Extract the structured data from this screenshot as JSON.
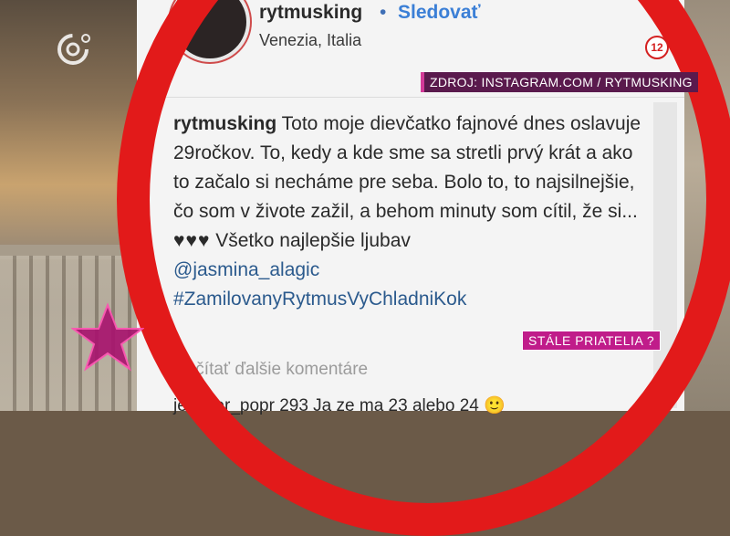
{
  "post": {
    "header_username": "rytmusking",
    "header_dot": "•",
    "follow_label": "Sledovať",
    "location": "Venezia, Italia"
  },
  "caption": {
    "username": "rytmusking",
    "text": "Toto moje dievčatko fajnové dnes oslavuje 29ročkov. To, kedy a kde sme sa stretli prvý krát a ako to začalo si necháme pre seba. Bolo to, to najsilnejšie, čo som v živote zažil, a behom minuty som cítil, že si...",
    "hearts": "♥♥♥",
    "text_end": "Všetko najlepšie ljubav",
    "mention": "@jasmina_alagic",
    "hashtag": "#ZamilovanyRytmusVyChladniKok"
  },
  "comments": {
    "load_more_label": "Načítať ďalšie komentáre",
    "next_comment_text": "jennifer_popr 293 Ja ze ma 23 alebo 24 🙂"
  },
  "overlay": {
    "source_label": "ZDROJ: INSTAGRAM.COM / RYTMUSKING",
    "age_rating": "12",
    "lower_tag": "STÁLE PRIATELIA ?",
    "accent_ring_color": "#e21a1a",
    "tag_color": "#5a1a4d",
    "lower_tag_color": "#c01c8a"
  },
  "icons": {
    "channel_logo": "channel-logo-icon",
    "star": "star-icon"
  }
}
